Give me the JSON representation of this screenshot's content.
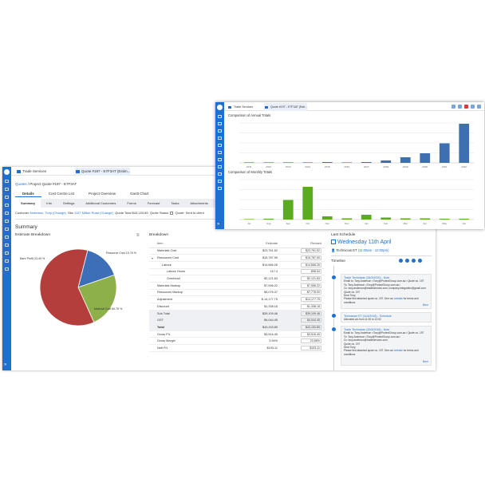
{
  "back": {
    "tabs": [
      "Trade Services",
      "Quote #197 - E7F3AT (Estim..."
    ],
    "breadcrumb_link": "Quotes",
    "breadcrumb_rest": "/ Project Quote #197 - E7F3AT",
    "page_tabs": [
      "Details",
      "Cost Centre List",
      "Project Overview",
      "Gantt Chart"
    ],
    "sub_tabs": [
      "Summary",
      "Info",
      "Settings",
      "Additional Customers",
      "Forms",
      "Forecast",
      "Tasks",
      "Attachments",
      "Logs"
    ],
    "customer_line": {
      "customer_label": "Customer",
      "customer_value": "Anderson, Tony (Change)",
      "site_label": "Site",
      "site_value": "1137 Milton Road (Change)",
      "quote_total_label": "Quote Total",
      "quote_total_value": "$43,153.89",
      "quote_status_label": "Quote Status",
      "quote_status_value": "Quote: Sent to client"
    },
    "summary_title": "Summary",
    "estimate_title": "Estimate Breakdown",
    "pie_labels": {
      "resource": "Resource Cost 15.76 %",
      "bare": "Bare Profit 23.49 %",
      "material": "Material Cost 60.75 %"
    },
    "breakdown_title": "Breakdown",
    "breakdown_headers": [
      "Item",
      "Estimate",
      "Revised"
    ],
    "breakdown_rows": [
      {
        "item": "Materials Cost",
        "estimate": "$23,761.52",
        "revised": "$23,761.52",
        "style": ""
      },
      {
        "item": "Resources Cost",
        "estimate": "$15,787.90",
        "revised": "$15,787.90",
        "style": "arrow"
      },
      {
        "item": "Labour",
        "estimate": "$14,666.26",
        "revised": "$14,666.26",
        "style": "indent"
      },
      {
        "item": "Labour Hours",
        "estimate": "117.4",
        "revised": "$98.54",
        "style": "indent2"
      },
      {
        "item": "Overhead",
        "estimate": "$2,121.63",
        "revised": "$2,121.63",
        "style": "indent2"
      },
      {
        "item": "Materials Markup",
        "estimate": "$7,596.22",
        "revised": "$7,596.22",
        "style": ""
      },
      {
        "item": "Resources Markup",
        "estimate": "$4,076.37",
        "revised": "$7,778.00",
        "style": ""
      },
      {
        "item": "Adjustment",
        "estimate": "$-14,177.75",
        "revised": "$14,177.75",
        "style": ""
      },
      {
        "item": "Discount",
        "estimate": "$1,338.18",
        "revised": "$1,338.18",
        "style": ""
      },
      {
        "item": "Sub Total",
        "estimate": "$39,109.46",
        "revised": "$39,109.46",
        "style": "total"
      },
      {
        "item": "GST",
        "estimate": "$4,044.45",
        "revised": "$4,044.45",
        "style": "total"
      },
      {
        "item": "Total",
        "estimate": "$43,153.89",
        "revised": "$43,153.89",
        "style": "total bold"
      },
      {
        "item": "Gross P/L",
        "estimate": "$3,516.49",
        "revised": "$3,516.49",
        "style": ""
      },
      {
        "item": "Gross Margin",
        "estimate": "3.94%",
        "revised": "23.66%",
        "style": ""
      },
      {
        "item": "Nett P/L",
        "estimate": "$193.11",
        "revised": "$193.11",
        "style": ""
      }
    ],
    "last_schedule_title": "Last Schedule",
    "last_schedule_date": "Wednesday 11th April",
    "last_schedule_tech": "Technician ET",
    "last_schedule_time": "(11:00am - 12:00pm)",
    "timeline_title": "Timeline",
    "timeline": [
      {
        "head": "Trade Technician (26/3/2020) - Note",
        "lines": [
          "Email to: Tony Anderson <Tony@ProtectGroup.com.au> Quote no. 197",
          "To: Tony Anderson <Tony@ProtectGroup.com.au>",
          "Cc: tony.anderson@tradeservices.com; company.integration@gmail.com",
          "Quote no. 197",
          "Dear Tony,"
        ],
        "body": "Please find attached quote no. 197. See our",
        "link": "website",
        "tail": "for terms and conditions"
      },
      {
        "head": "Technician ET (11/4/2018) - Schedule",
        "lines": [
          "Allocated a/c from 11:00 to 12:00"
        ],
        "body": "",
        "link": "",
        "tail": ""
      },
      {
        "head": "Trade Technician (20/3/2018) - Note",
        "lines": [
          "Email to: Tony Anderson <Tony@ProtectGroup.com.au> Quote no. 197",
          "To: Tony Anderson <Tony@ProtectGroup.com.au>",
          "Cc: tony.anderson@tradeservices.com",
          "Quote no. 197",
          "Dear Tony,"
        ],
        "body": "Please find attached quote no. 197. See our",
        "link": "website",
        "tail": "for terms and conditions"
      }
    ],
    "more_label": "More"
  },
  "front": {
    "tabs": [
      "Trade Services",
      "Quote #197 - E7F3AT (Esti..."
    ],
    "annual_title": "Comparison of Annual Totals",
    "monthly_title": "Comparison of Monthly Totals"
  },
  "chart_data": [
    {
      "type": "pie",
      "title": "Estimate Breakdown",
      "categories": [
        "Resource Cost",
        "Bare Profit",
        "Material Cost"
      ],
      "values": [
        15.76,
        23.49,
        60.75
      ],
      "colors": [
        "#3c6fb8",
        "#8db04a",
        "#b33e3b"
      ]
    },
    {
      "type": "bar",
      "title": "Comparison of Annual Totals",
      "categories": [
        "2011",
        "2012",
        "2013",
        "2014",
        "2015",
        "2016",
        "2017",
        "2018",
        "2019",
        "2020",
        "2021",
        "2022"
      ],
      "values": [
        0.1,
        0.1,
        0.1,
        0.1,
        0.2,
        0.1,
        0.2,
        0.6,
        1.4,
        2.4,
        4.9,
        9.8
      ],
      "ylim": [
        0,
        10
      ],
      "color": "#3d6fb1",
      "grid": true
    },
    {
      "type": "bar",
      "title": "Comparison of Monthly Totals",
      "categories": [
        "Jul",
        "Aug",
        "Sep",
        "Oct",
        "Nov",
        "Dec",
        "Jan",
        "Feb",
        "Mar",
        "Apr",
        "May",
        "Jun"
      ],
      "values": [
        0.1,
        0.2,
        4.9,
        8.2,
        0.8,
        0.3,
        1.2,
        0.5,
        0.3,
        0.3,
        0.2,
        0.2
      ],
      "ylim": [
        0,
        10
      ],
      "color": "#5aab1e",
      "grid": true
    }
  ]
}
